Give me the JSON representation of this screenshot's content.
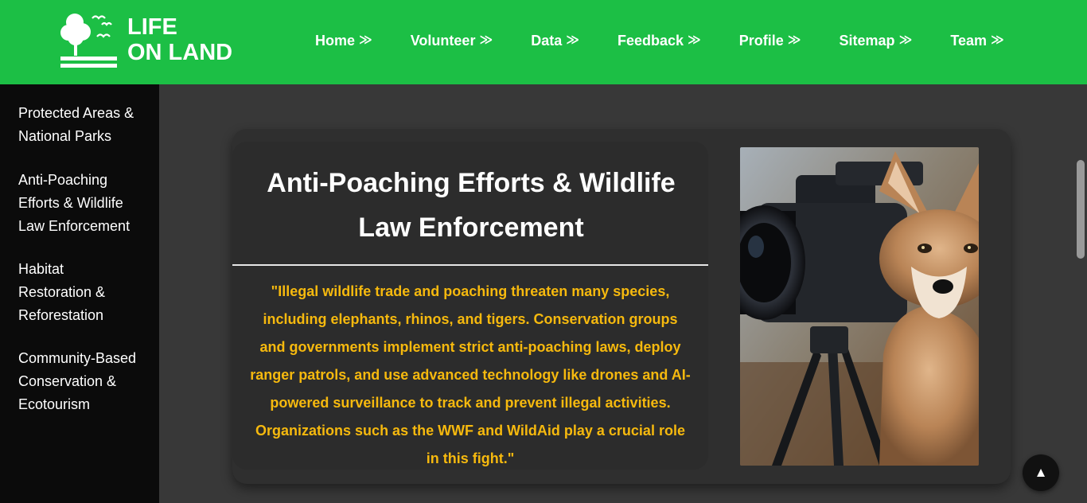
{
  "brand": {
    "line1": "LIFE",
    "line2": "ON LAND"
  },
  "nav": [
    {
      "label": "Home",
      "arrow": "≫"
    },
    {
      "label": "Volunteer",
      "arrow": "≫"
    },
    {
      "label": "Data",
      "arrow": "≫"
    },
    {
      "label": "Feedback",
      "arrow": "≫"
    },
    {
      "label": "Profile",
      "arrow": "≫"
    },
    {
      "label": "Sitemap",
      "arrow": "≫"
    },
    {
      "label": "Team",
      "arrow": "≫"
    }
  ],
  "sidebar": {
    "items": [
      {
        "lines": [
          "Protected Areas &",
          "National Parks"
        ]
      },
      {
        "lines": [
          "Anti-Poaching",
          "Efforts & Wildlife",
          "Law Enforcement"
        ]
      },
      {
        "lines": [
          "Habitat",
          "Restoration &",
          "Reforestation"
        ]
      },
      {
        "lines": [
          "Community-Based",
          "Conservation &",
          "Ecotourism"
        ]
      }
    ]
  },
  "main": {
    "title_lines": [
      "Anti-Poaching Efforts & Wildlife",
      "Law Enforcement"
    ],
    "quote_lines": [
      "\"Illegal wildlife trade and poaching threaten many species,",
      "including elephants, rhinos, and tigers. Conservation groups",
      "and governments implement strict anti-poaching laws, deploy",
      "ranger patrols, and use advanced technology like drones and AI-",
      "powered surveillance to track and prevent illegal activities.",
      "Organizations such as the WWF and WildAid play a crucial role",
      "in this fight.\""
    ]
  },
  "back_to_top": {
    "symbol": "▲"
  },
  "colors": {
    "header_bg": "#1cbf45",
    "sidebar_bg": "#0b0b0b",
    "page_bg": "#383838",
    "quote_text": "#f6b90e"
  },
  "icons": {
    "logo": "tree-birds-logo-icon",
    "nav_arrow": "double-chevron-right-icon",
    "back_to_top": "arrow-up-icon"
  }
}
